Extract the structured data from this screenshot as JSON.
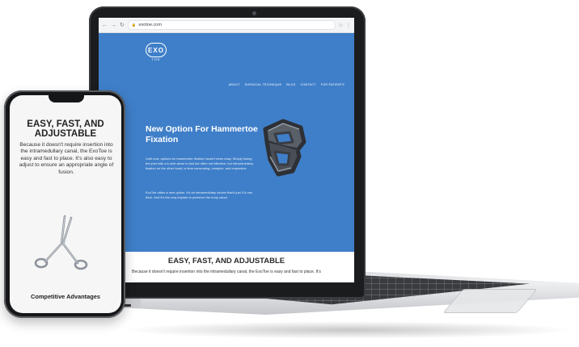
{
  "browser": {
    "back": "←",
    "forward": "→",
    "reload": "↻",
    "url": "exotoe.com",
    "lock": "🔒",
    "icons": [
      "☆",
      "⋮"
    ]
  },
  "site": {
    "logo": "EXO",
    "logo_sub": "TOE",
    "nav": [
      "ABOUT",
      "SURGICAL TECHNIQUE",
      "BLOG",
      "CONTACT",
      "FOR PATIENTS"
    ],
    "hero_title": "New Option For Hammertoe Fixation",
    "hero_p1": "Until now, options for hammertoe fixation haven't been easy. Simply fusing the joint with a k-wire alone is fast but often not effective, but intramedullary fixation on the other hand, is time consuming, complex, and expensive.",
    "hero_p2": "ExoToe offers a new option. It's an intramedullary device that's just 0.6 mm thick. And it's the only implant to preserve the bony canal.",
    "section_title": "EASY, FAST, AND ADJUSTABLE",
    "section_text": "Because it doesn't require insertion into the intramedullary canal, the ExoToe is easy and fast to place. It's",
    "colors": {
      "hero_bg": "#3f7fc9"
    }
  },
  "phone": {
    "title": "EASY, FAST, AND ADJUSTABLE",
    "body_italic": "Because it doesn't require insertion into the intramedullary canal, the ExoToe is easy and fast to place. It's also easy to adjust to ensure an appropriate angle of fusion.",
    "footer": "Competitive Advantages"
  }
}
